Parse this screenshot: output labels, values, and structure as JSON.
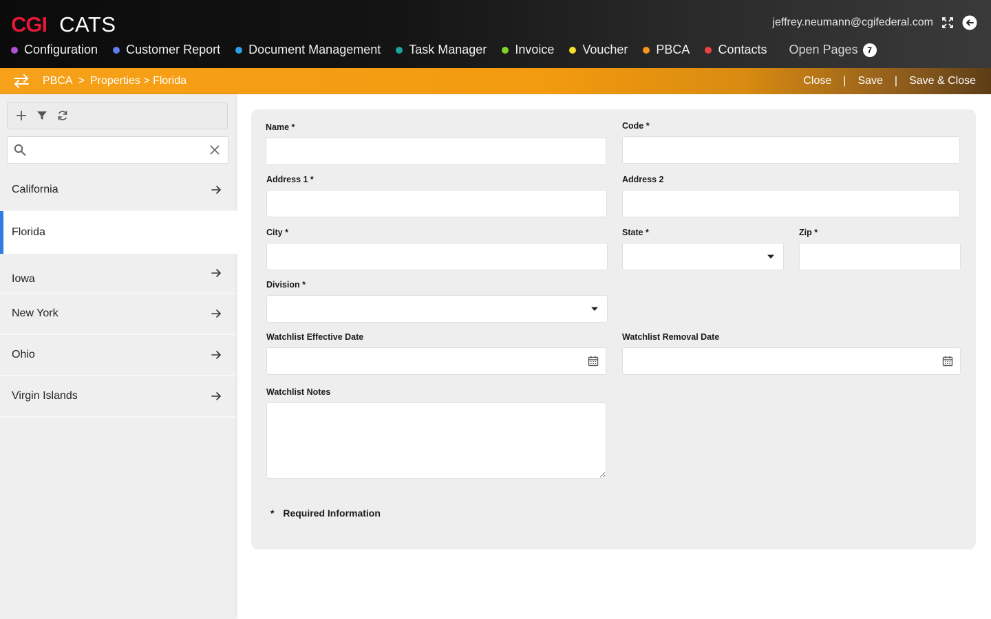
{
  "brand": {
    "logo": "CGI",
    "app_name": "CATS"
  },
  "user": {
    "email": "jeffrey.neumann@cgifederal.com"
  },
  "nav": {
    "items": [
      {
        "label": "Configuration",
        "color": "#b04fd6"
      },
      {
        "label": "Customer Report",
        "color": "#5f7cf0"
      },
      {
        "label": "Document Management",
        "color": "#27a2e8"
      },
      {
        "label": "Task Manager",
        "color": "#1aa6a0"
      },
      {
        "label": "Invoice",
        "color": "#7ed22b"
      },
      {
        "label": "Voucher",
        "color": "#f3e12b"
      },
      {
        "label": "PBCA",
        "color": "#f7941d"
      },
      {
        "label": "Contacts",
        "color": "#ee4040"
      }
    ],
    "open_pages": {
      "label": "Open Pages",
      "count": "7"
    }
  },
  "breadcrumb": {
    "root": "PBCA",
    "sep1": ">",
    "level2": "Properties > Florida"
  },
  "actions": {
    "close": "Close",
    "sep1": "|",
    "save": "Save",
    "sep2": "|",
    "save_close": "Save & Close"
  },
  "sidebar": {
    "search": {
      "value": "",
      "placeholder": ""
    },
    "items": [
      {
        "label": "California"
      },
      {
        "label": "Florida"
      },
      {
        "label": "Iowa"
      },
      {
        "label": "New York"
      },
      {
        "label": "Ohio"
      },
      {
        "label": "Virgin Islands"
      }
    ]
  },
  "form": {
    "name": {
      "label": "Name *",
      "value": ""
    },
    "code": {
      "label": "Code *",
      "value": ""
    },
    "address1": {
      "label": "Address 1 *",
      "value": ""
    },
    "address2": {
      "label": "Address 2",
      "value": ""
    },
    "city": {
      "label": "City *",
      "value": ""
    },
    "state": {
      "label": "State *",
      "value": ""
    },
    "zip": {
      "label": "Zip *",
      "value": ""
    },
    "division": {
      "label": "Division *",
      "value": ""
    },
    "watch_effective": {
      "label": "Watchlist Effective Date",
      "value": ""
    },
    "watch_removal": {
      "label": "Watchlist Removal Date",
      "value": ""
    },
    "watch_notes": {
      "label": "Watchlist Notes",
      "value": ""
    },
    "required_star": "*",
    "required_note": "Required Information"
  }
}
